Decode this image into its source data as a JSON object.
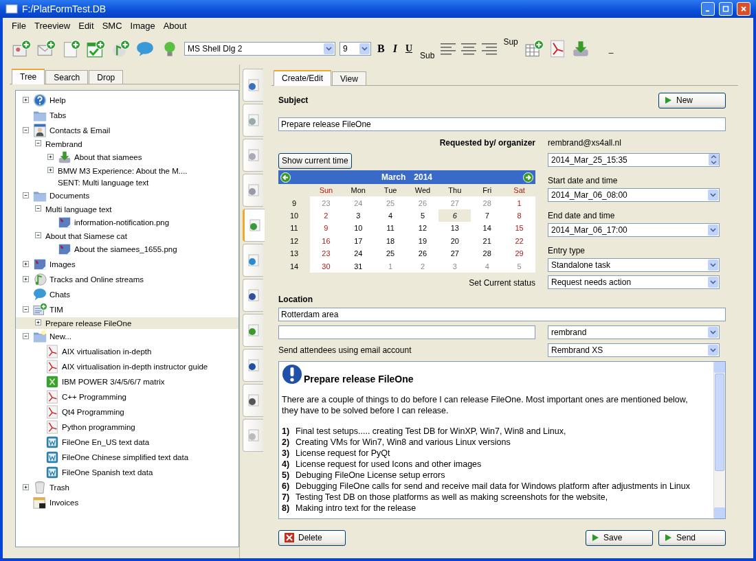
{
  "window": {
    "title": "F:/PlatFormTest.DB"
  },
  "menu": [
    "File",
    "Treeview",
    "Edit",
    "SMC",
    "Image",
    "About"
  ],
  "toolbar": {
    "font": "MS Shell Dlg 2",
    "size": "9",
    "bold": "B",
    "italic": "I",
    "underline": "U",
    "sub": "Sub",
    "sup": "Sup",
    "extra": "_"
  },
  "left_tabs": [
    {
      "label": "Tree",
      "selected": true
    },
    {
      "label": "Search",
      "selected": false
    },
    {
      "label": "Drop",
      "selected": false
    }
  ],
  "tree": [
    {
      "label": "Help",
      "kind": "help",
      "expanded": false,
      "selected": false
    },
    {
      "label": "Tabs",
      "kind": "folder",
      "selected": false
    },
    {
      "label": "Contacts & Email",
      "kind": "contact",
      "expanded": true,
      "selected": false,
      "children": [
        {
          "label": "Rembrand",
          "kind": "text",
          "expanded": true,
          "selected": false,
          "children": [
            {
              "label": "About that siamees",
              "kind": "download",
              "expanded": false,
              "selected": false
            },
            {
              "label": "BMW M3 Experience: About the M....",
              "kind": "text",
              "expanded": false,
              "selected": false
            },
            {
              "label": "SENT: Multi language text",
              "kind": "text",
              "selected": false
            }
          ]
        }
      ]
    },
    {
      "label": "Documents",
      "kind": "folder",
      "expanded": true,
      "selected": false,
      "children": [
        {
          "label": "Multi language text",
          "kind": "text",
          "expanded": true,
          "selected": false,
          "children": [
            {
              "label": "information-notification.png",
              "kind": "image",
              "selected": false
            }
          ]
        },
        {
          "label": "About that Siamese cat",
          "kind": "text",
          "expanded": true,
          "selected": false,
          "children": [
            {
              "label": "About the siamees_1655.png",
              "kind": "image",
              "selected": false
            }
          ]
        }
      ]
    },
    {
      "label": "Images",
      "kind": "image",
      "expanded": false,
      "selected": false
    },
    {
      "label": "Tracks and Online streams",
      "kind": "music",
      "expanded": false,
      "selected": false
    },
    {
      "label": "Chats",
      "kind": "chat",
      "selected": false
    },
    {
      "label": "TIM",
      "kind": "tim",
      "expanded": true,
      "selected": false,
      "children": [
        {
          "label": "Prepare release FileOne",
          "kind": "text",
          "expanded": false,
          "selected": true
        }
      ]
    },
    {
      "label": "New...",
      "kind": "folder-new",
      "expanded": true,
      "selected": false,
      "children": [
        {
          "label": "AIX virtualisation in-depth",
          "kind": "pdf",
          "selected": false
        },
        {
          "label": "AIX virtualisation in-depth instructor guide",
          "kind": "pdf",
          "selected": false
        },
        {
          "label": "IBM POWER 3/4/5/6/7 matrix",
          "kind": "excel",
          "selected": false
        },
        {
          "label": "C++ Programming",
          "kind": "pdf",
          "selected": false
        },
        {
          "label": "Qt4 Programming",
          "kind": "pdf",
          "selected": false
        },
        {
          "label": "Python programming",
          "kind": "pdf",
          "selected": false
        },
        {
          "label": "FileOne En_US text data",
          "kind": "word",
          "selected": false
        },
        {
          "label": "FileOne Chinese simplified text data",
          "kind": "word",
          "selected": false
        },
        {
          "label": "FileOne Spanish text data",
          "kind": "word",
          "selected": false
        }
      ]
    },
    {
      "label": "Trash",
      "kind": "trash",
      "expanded": false,
      "selected": false
    },
    {
      "label": "Invoices",
      "kind": "invoice",
      "selected": false
    }
  ],
  "side_tabs": [
    {
      "selected": false
    },
    {
      "selected": false
    },
    {
      "selected": false
    },
    {
      "selected": false
    },
    {
      "selected": true
    },
    {
      "selected": false
    },
    {
      "selected": false
    },
    {
      "selected": false
    },
    {
      "selected": false
    },
    {
      "selected": false
    },
    {
      "selected": false
    }
  ],
  "form_tabs": [
    {
      "label": "Create/Edit",
      "selected": true
    },
    {
      "label": "View",
      "selected": false
    }
  ],
  "subject": {
    "label": "Subject",
    "value": "Prepare release FileOne"
  },
  "new_button": "New",
  "organizer": {
    "label": "Requested by/ organizer",
    "value": "rembrand@xs4all.nl"
  },
  "show_time_button": "Show current time",
  "current_time": "2014_Mar_25_15:35",
  "calendar": {
    "month": "March",
    "year": "2014",
    "weekdays": [
      "Sun",
      "Mon",
      "Tue",
      "Wed",
      "Thu",
      "Fri",
      "Sat"
    ],
    "weeks": [
      {
        "week": "9",
        "days": [
          {
            "d": "23",
            "muted": true,
            "selected": false
          },
          {
            "d": "24",
            "muted": true,
            "selected": false
          },
          {
            "d": "25",
            "muted": true,
            "selected": false
          },
          {
            "d": "26",
            "muted": true,
            "selected": false
          },
          {
            "d": "27",
            "muted": true,
            "selected": false
          },
          {
            "d": "28",
            "muted": true,
            "selected": false
          },
          {
            "d": "1",
            "muted": false,
            "selected": false
          }
        ]
      },
      {
        "week": "10",
        "days": [
          {
            "d": "2",
            "muted": false,
            "selected": false
          },
          {
            "d": "3",
            "muted": false,
            "selected": false
          },
          {
            "d": "4",
            "muted": false,
            "selected": false
          },
          {
            "d": "5",
            "muted": false,
            "selected": false
          },
          {
            "d": "6",
            "muted": false,
            "selected": true
          },
          {
            "d": "7",
            "muted": false,
            "selected": false
          },
          {
            "d": "8",
            "muted": false,
            "selected": false
          }
        ]
      },
      {
        "week": "11",
        "days": [
          {
            "d": "9",
            "muted": false,
            "selected": false
          },
          {
            "d": "10",
            "muted": false,
            "selected": false
          },
          {
            "d": "11",
            "muted": false,
            "selected": false
          },
          {
            "d": "12",
            "muted": false,
            "selected": false
          },
          {
            "d": "13",
            "muted": false,
            "selected": false
          },
          {
            "d": "14",
            "muted": false,
            "selected": false
          },
          {
            "d": "15",
            "muted": false,
            "selected": false
          }
        ]
      },
      {
        "week": "12",
        "days": [
          {
            "d": "16",
            "muted": false,
            "selected": false
          },
          {
            "d": "17",
            "muted": false,
            "selected": false
          },
          {
            "d": "18",
            "muted": false,
            "selected": false
          },
          {
            "d": "19",
            "muted": false,
            "selected": false
          },
          {
            "d": "20",
            "muted": false,
            "selected": false
          },
          {
            "d": "21",
            "muted": false,
            "selected": false
          },
          {
            "d": "22",
            "muted": false,
            "selected": false
          }
        ]
      },
      {
        "week": "13",
        "days": [
          {
            "d": "23",
            "muted": false,
            "selected": false
          },
          {
            "d": "24",
            "muted": false,
            "selected": false
          },
          {
            "d": "25",
            "muted": false,
            "selected": false
          },
          {
            "d": "26",
            "muted": false,
            "selected": false
          },
          {
            "d": "27",
            "muted": false,
            "selected": false
          },
          {
            "d": "28",
            "muted": false,
            "selected": false
          },
          {
            "d": "29",
            "muted": false,
            "selected": false
          }
        ]
      },
      {
        "week": "14",
        "days": [
          {
            "d": "30",
            "muted": false,
            "selected": false
          },
          {
            "d": "31",
            "muted": false,
            "selected": false
          },
          {
            "d": "1",
            "muted": true,
            "selected": false
          },
          {
            "d": "2",
            "muted": true,
            "selected": false
          },
          {
            "d": "3",
            "muted": true,
            "selected": false
          },
          {
            "d": "4",
            "muted": true,
            "selected": false
          },
          {
            "d": "5",
            "muted": true,
            "selected": false
          }
        ]
      }
    ]
  },
  "fields": [
    {
      "label": "Start date and time",
      "value": "2014_Mar_06_08:00"
    },
    {
      "label": "End date and time",
      "value": "2014_Mar_06_17:00"
    },
    {
      "label": "Entry type",
      "value": "Standalone task"
    }
  ],
  "status": {
    "label": "Set Current status",
    "value": "Request needs action"
  },
  "location": {
    "label": "Location",
    "value": "Rotterdam area"
  },
  "attendee_account": "rembrand",
  "send_account": {
    "label": "Send attendees using email account",
    "value": "Rembrand XS"
  },
  "note": {
    "heading": "Prepare release FileOne",
    "intro": "There are a couple of things to do before I can release FileOne.  Most important ones are mentioned below, they have to be solved before I can release.",
    "items": [
      {
        "num": "1)",
        "text": "Final test setups..... creating Test DB for WinXP, Win7, Win8 and Linux,"
      },
      {
        "num": "2)",
        "text": "Creating VMs for Win7, Win8 and various Linux versions"
      },
      {
        "num": "3)",
        "text": "License request for PyQt"
      },
      {
        "num": "4)",
        "text": "License request for used Icons and other images"
      },
      {
        "num": "5)",
        "text": "Debuging FileOne License setup errors"
      },
      {
        "num": "6)",
        "text": "Debugging FileOne calls for send and receive mail data for Windows platform after adjustments in Linux"
      },
      {
        "num": "7)",
        "text": "Testing Test DB on those platforms as well as making screenshots for the website,"
      },
      {
        "num": "8)",
        "text": "Making intro text for the release"
      }
    ]
  },
  "buttons": {
    "delete": "Delete",
    "save": "Save",
    "send": "Send"
  }
}
